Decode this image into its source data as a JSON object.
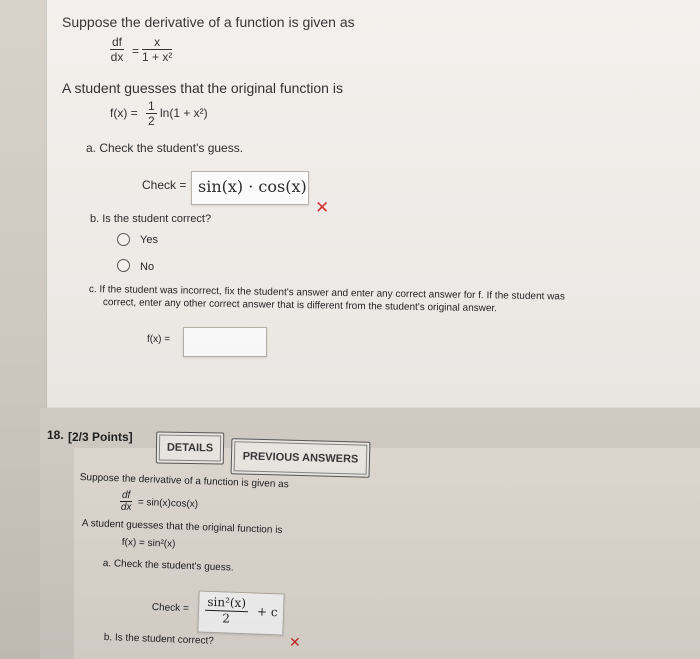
{
  "upper": {
    "intro": "Suppose the derivative of a function is given as",
    "deriv_lhs_num": "df",
    "deriv_lhs_den": "dx",
    "equals": "=",
    "deriv_rhs_num": "x",
    "deriv_rhs_den": "1 + x²",
    "guess_intro": "A student guesses that the original function is",
    "guess_lhs": "f(x) =",
    "guess_coef_num": "1",
    "guess_coef_den": "2",
    "guess_rhs": "ln(1 + x²)",
    "part_a": "a. Check the student's guess.",
    "check_label": "Check =",
    "check_value": "sin(x) · cos(x)",
    "wrong_mark": "✕",
    "part_b": "b. Is the student correct?",
    "option_yes": "Yes",
    "option_no": "No",
    "part_c_line1": "c. If the student was incorrect, fix the student's answer and enter any correct answer for f. If the student was",
    "part_c_line2": "correct, enter any other correct answer that is different from the student's original answer.",
    "f_label": "f(x) =",
    "f_value": ""
  },
  "q18": {
    "number": "18.",
    "points": "[2/3 Points]",
    "details_btn": "DETAILS",
    "prev_btn": "PREVIOUS ANSWERS",
    "intro": "Suppose the derivative of a function is given as",
    "deriv_lhs_num": "df",
    "deriv_lhs_den": "dx",
    "deriv_rhs": "= sin(x)cos(x)",
    "guess_intro": "A student guesses that the original function is",
    "guess": "f(x) = sin²(x)",
    "part_a": "a. Check the student's guess.",
    "check_label": "Check =",
    "check_num": "sin²(x)",
    "check_den": "2",
    "check_tail": "+ c",
    "wrong_mark": "✕",
    "part_b": "b. Is the student correct?"
  }
}
